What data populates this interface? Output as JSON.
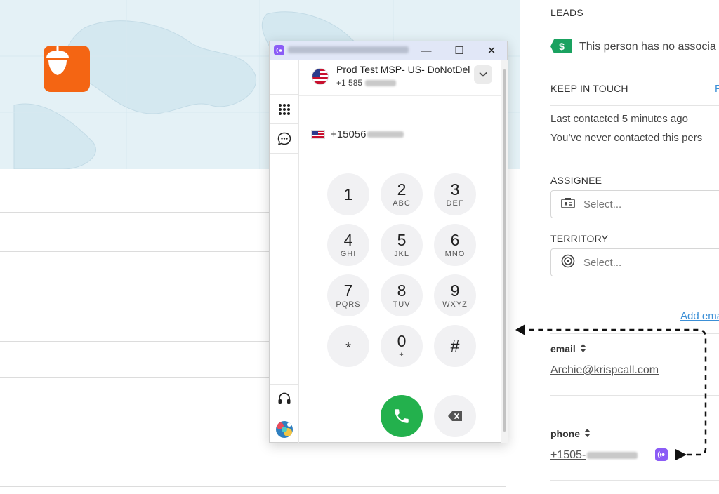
{
  "dialer": {
    "account_name": "Prod Test MSP- US- DoNotDel",
    "account_number": "+1 585",
    "dialed_number": "+15056",
    "keys": [
      {
        "digit": "1",
        "letters": ""
      },
      {
        "digit": "2",
        "letters": "ABC"
      },
      {
        "digit": "3",
        "letters": "DEF"
      },
      {
        "digit": "4",
        "letters": "GHI"
      },
      {
        "digit": "5",
        "letters": "JKL"
      },
      {
        "digit": "6",
        "letters": "MNO"
      },
      {
        "digit": "7",
        "letters": "PQRS"
      },
      {
        "digit": "8",
        "letters": "TUV"
      },
      {
        "digit": "9",
        "letters": "WXYZ"
      },
      {
        "digit": "*",
        "letters": ""
      },
      {
        "digit": "0",
        "letters": "+"
      },
      {
        "digit": "#",
        "letters": ""
      }
    ],
    "window_buttons": {
      "minimize": "—",
      "maximize": "☐",
      "close": "✕"
    }
  },
  "right_panel": {
    "leads_title": "LEADS",
    "leads_text": "This person has no associa",
    "keep_title": "KEEP IN TOUCH",
    "keep_link": "F",
    "last_contacted": "Last contacted 5 minutes ago",
    "never_contacted": "You’ve never contacted this pers",
    "assignee_title": "ASSIGNEE",
    "assignee_placeholder": "Select...",
    "territory_title": "TERRITORY",
    "territory_placeholder": "Select...",
    "add_email": "Add ema",
    "email_label": "email",
    "email_value": "Archie@krispcall.com",
    "phone_label": "phone",
    "phone_value": "+1505-"
  },
  "colors": {
    "brand_orange": "#f46513",
    "call_green": "#23b14d",
    "link_blue": "#3b8fd6",
    "krispcall_purple": "#8b5cf6",
    "lead_green": "#1aa260"
  }
}
